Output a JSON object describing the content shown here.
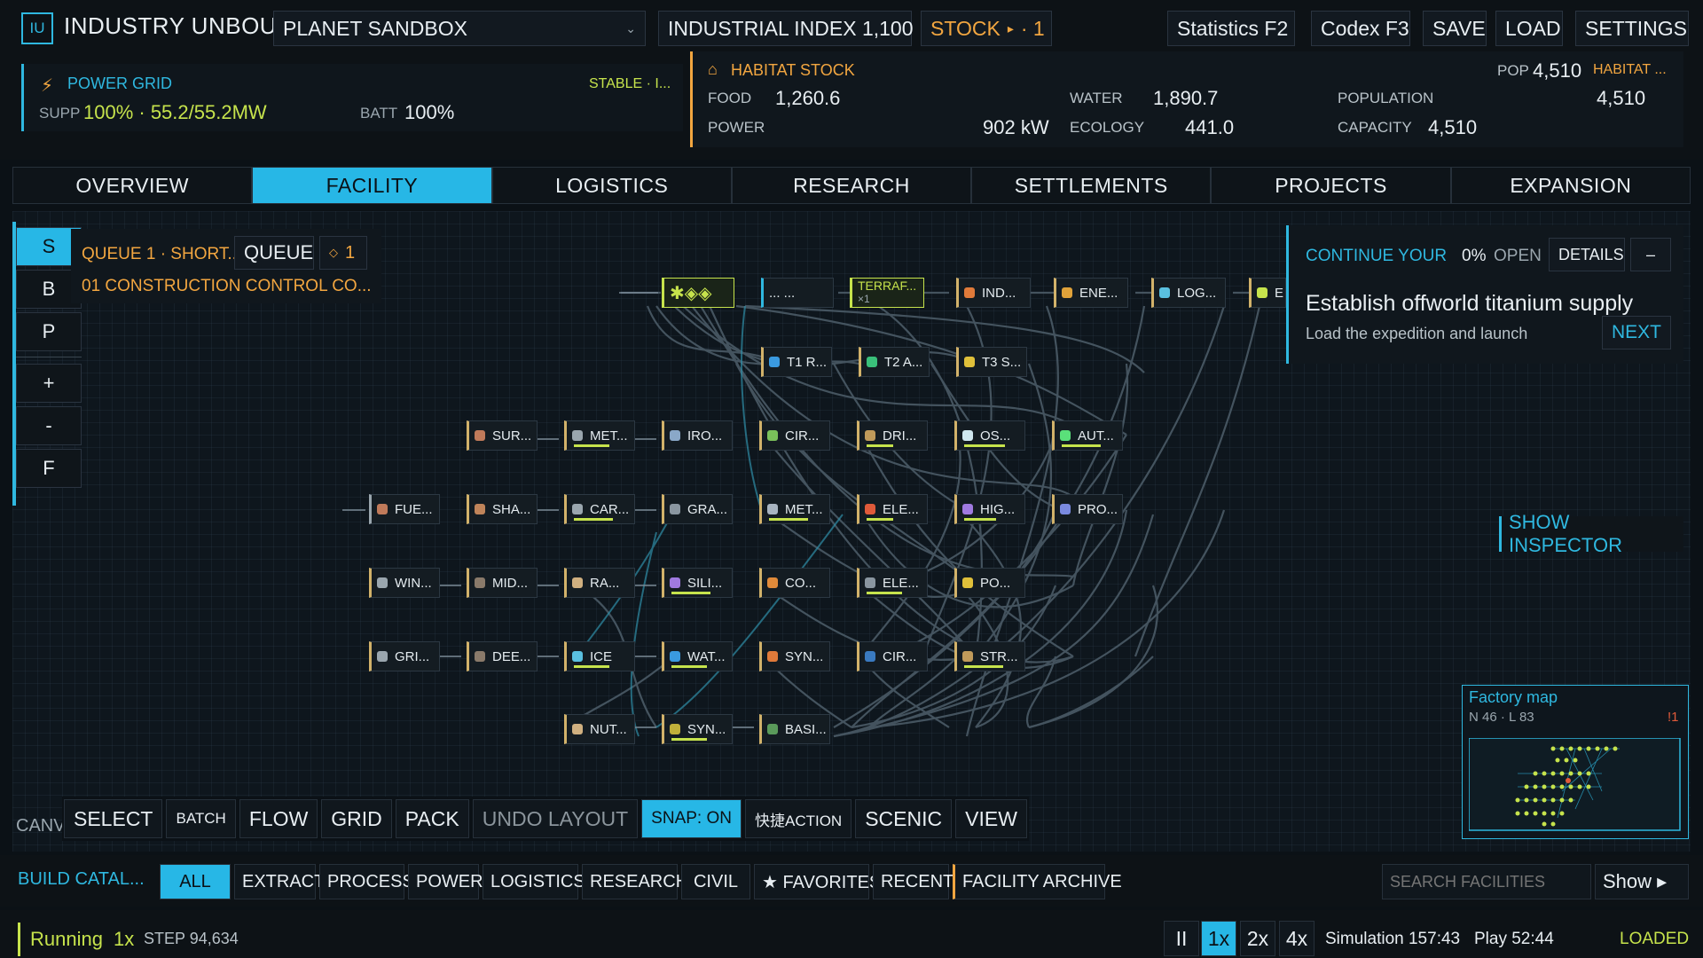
{
  "app": {
    "logo": "IU",
    "title": "INDUSTRY UNBOU"
  },
  "header": {
    "planet_select": "PLANET SANDBOX",
    "industrial_index": "INDUSTRIAL INDEX 1,100",
    "stock_label": "STOCK",
    "stock_arrow": "▸",
    "stock_count": "· 1",
    "buttons": [
      "Statistics F2",
      "Codex F3",
      "SAVE",
      "LOAD",
      "SETTINGS"
    ]
  },
  "power": {
    "title": "POWER GRID",
    "status": "STABLE · I...",
    "supp_label": "SUPP",
    "supp_value": "100% · 55.2/55.2MW",
    "batt_label": "BATT",
    "batt_value": "100%"
  },
  "habitat": {
    "title": "HABITAT STOCK",
    "pop_label": "POP",
    "pop_value": "4,510",
    "habitat_trunc": "HABITAT ...",
    "food_label": "FOOD",
    "food_value": "1,260.6",
    "power_label": "POWER",
    "power_value": "902 kW",
    "water_label": "WATER",
    "water_value": "1,890.7",
    "ecology_label": "ECOLOGY",
    "ecology_value": "441.0",
    "population_label": "POPULATION",
    "population_value": "4,510",
    "capacity_label": "CAPACITY",
    "capacity_value": "4,510"
  },
  "tabs": [
    "OVERVIEW",
    "FACILITY",
    "LOGISTICS",
    "RESEARCH",
    "SETTLEMENTS",
    "PROJECTS",
    "EXPANSION"
  ],
  "active_tab": "FACILITY",
  "side_tools": [
    "S",
    "B",
    "P",
    "+",
    "-",
    "F"
  ],
  "queue": {
    "title": "QUEUE 1 · SHORT...",
    "button": "QUEUE",
    "badge_icon": "◇",
    "badge_count": "1",
    "item": "01  CONSTRUCTION CONTROL CO..."
  },
  "nodes": [
    {
      "label": "... ..."
    },
    {
      "label": "TERRAF...",
      "sub": "×1"
    },
    {
      "label": "IND..."
    },
    {
      "label": "ENE..."
    },
    {
      "label": "LOG..."
    },
    {
      "label": "E"
    },
    {
      "label": "T1 R..."
    },
    {
      "label": "T2 A..."
    },
    {
      "label": "T3 S..."
    },
    {
      "label": "SUR..."
    },
    {
      "label": "MET..."
    },
    {
      "label": "IRO..."
    },
    {
      "label": "CIR..."
    },
    {
      "label": "DRI..."
    },
    {
      "label": "OS..."
    },
    {
      "label": "AUT..."
    },
    {
      "label": "FUE..."
    },
    {
      "label": "SHA..."
    },
    {
      "label": "CAR..."
    },
    {
      "label": "GRA..."
    },
    {
      "label": "MET..."
    },
    {
      "label": "ELE..."
    },
    {
      "label": "HIG..."
    },
    {
      "label": "PRO..."
    },
    {
      "label": "WIN..."
    },
    {
      "label": "MID..."
    },
    {
      "label": "RA..."
    },
    {
      "label": "SILI..."
    },
    {
      "label": "CO..."
    },
    {
      "label": "ELE..."
    },
    {
      "label": "PO..."
    },
    {
      "label": "GRI..."
    },
    {
      "label": "DEE..."
    },
    {
      "label": "ICE"
    },
    {
      "label": "WAT..."
    },
    {
      "label": "SYN..."
    },
    {
      "label": "CIR..."
    },
    {
      "label": "STR..."
    },
    {
      "label": "NUT..."
    },
    {
      "label": "SYN..."
    },
    {
      "label": "BASI..."
    }
  ],
  "objective": {
    "title": "CONTINUE YOUR",
    "percent": "0%",
    "open_label": "OPEN",
    "details_button": "DETAILS",
    "collapse_button": "–",
    "headline": "Establish offworld titanium supply",
    "sub": "Load the expedition and launch",
    "next_button": "NEXT"
  },
  "show_inspector": "SHOW INSPECTOR",
  "minimap": {
    "title": "Factory map",
    "stats": "N 46 · L 83",
    "alert": "!1"
  },
  "canvas_label": "CANV",
  "toolbar": [
    "SELECT",
    "BATCH",
    "FLOW",
    "GRID",
    "PACK",
    "UNDO LAYOUT",
    "SNAP: ON",
    "快捷ACTION",
    "SCENIC",
    "VIEW"
  ],
  "catalog": {
    "title": "BUILD CATAL...",
    "filters": [
      "ALL",
      "EXTRACT",
      "PROCESS",
      "POWER",
      "LOGISTICS",
      "RESEARCH",
      "CIVIL",
      "★ FAVORITES",
      "RECENT",
      "FACILITY ARCHIVE"
    ],
    "search_placeholder": "SEARCH FACILITIES",
    "show_button": "Show ▸"
  },
  "status": {
    "running": "Running",
    "speed": "1x",
    "step": "STEP 94,634",
    "pause": "II",
    "speeds": [
      "1x",
      "2x",
      "4x"
    ],
    "simulation": "Simulation 157:43",
    "play": "Play 52:44",
    "state": "LOADED"
  },
  "colors": {
    "accent": "#27b7e6",
    "warning": "#f2a640",
    "ok": "#c6e34c"
  }
}
